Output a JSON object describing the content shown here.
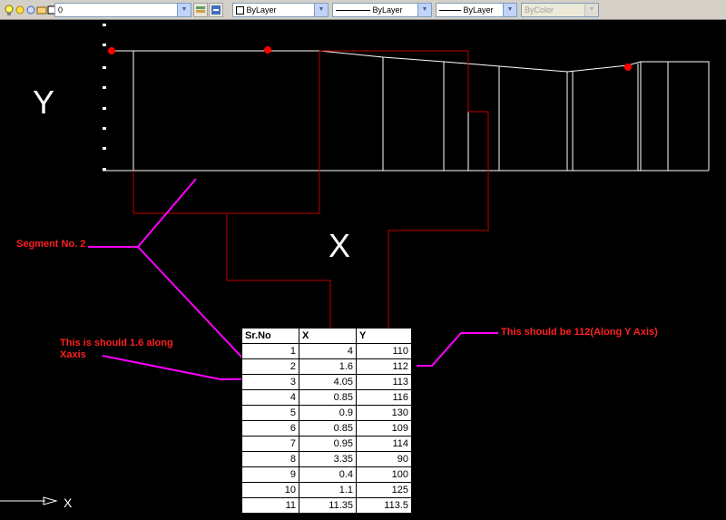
{
  "toolbar": {
    "layer_value": "0",
    "color_value": "ByLayer",
    "linetype_value": "ByLayer",
    "lineweight_value": "ByLayer",
    "plotstyle_value": "ByColor",
    "icons": [
      "lightbulb-icon",
      "sun-icon",
      "lock-icon",
      "color-swatch-icon",
      "layer-manager-icon",
      "layer-previous-icon"
    ]
  },
  "drawing": {
    "y_label": "Y",
    "x_label": "X",
    "ucs_x_label": "X",
    "annotation_segment": "Segment No. 2",
    "annotation_x": "This is should 1.6 along Xaxis",
    "annotation_y": "This should be 112(Along Y Axis)",
    "line_color": "#ffffff",
    "leader_color": "#ff00ff",
    "link_color": "#c00000",
    "point_color": "#ff0000"
  },
  "table": {
    "headers": [
      "Sr.No",
      "X",
      "Y"
    ],
    "rows": [
      [
        "1",
        "4",
        "110"
      ],
      [
        "2",
        "1.6",
        "112"
      ],
      [
        "3",
        "4.05",
        "113"
      ],
      [
        "4",
        "0.85",
        "116"
      ],
      [
        "5",
        "0.9",
        "130"
      ],
      [
        "6",
        "0.85",
        "109"
      ],
      [
        "7",
        "0.95",
        "114"
      ],
      [
        "8",
        "3.35",
        "90"
      ],
      [
        "9",
        "0.4",
        "100"
      ],
      [
        "10",
        "1.1",
        "125"
      ],
      [
        "11",
        "11.35",
        "113.5"
      ]
    ]
  }
}
